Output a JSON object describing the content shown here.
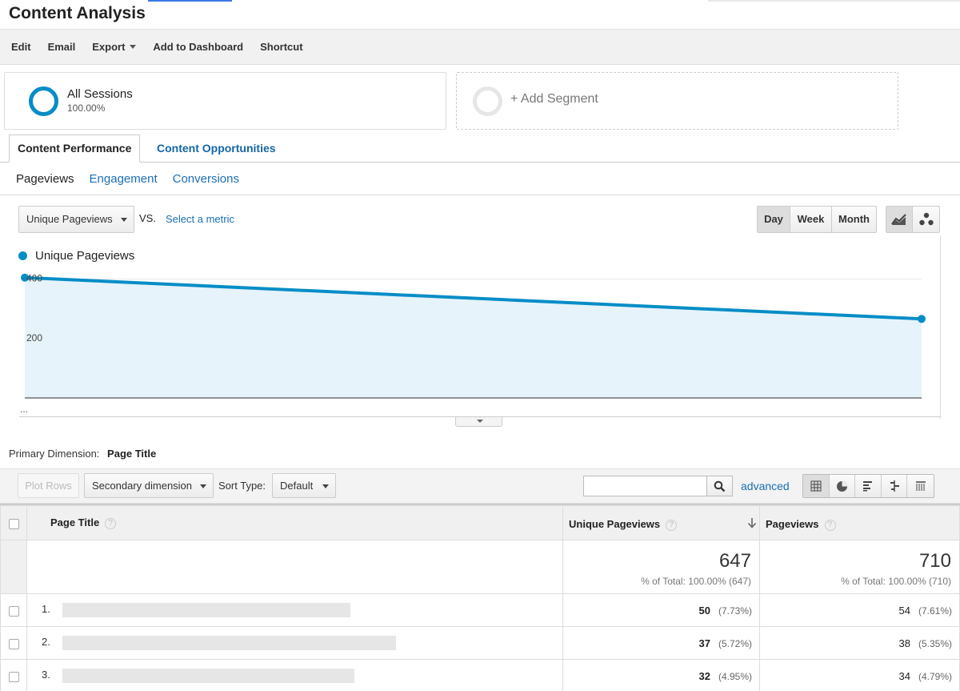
{
  "page": {
    "title": "Content Analysis"
  },
  "toolbar": {
    "edit": "Edit",
    "email": "Email",
    "export": "Export",
    "add_to_dashboard": "Add to Dashboard",
    "shortcut": "Shortcut"
  },
  "segments": {
    "active": {
      "name": "All Sessions",
      "percent": "100.00%"
    },
    "add_label": "+ Add Segment"
  },
  "report_tabs": [
    "Content Performance",
    "Content Opportunities"
  ],
  "sub_tabs": [
    "Pageviews",
    "Engagement",
    "Conversions"
  ],
  "chart_controls": {
    "metric": "Unique Pageviews",
    "vs": "VS.",
    "select_metric": "Select a metric",
    "periods": [
      "Day",
      "Week",
      "Month"
    ],
    "active_period": "Day",
    "chart_types": [
      "line-chart-icon",
      "motion-chart-icon"
    ]
  },
  "chart_data": {
    "type": "area",
    "series": [
      {
        "name": "Unique Pageviews",
        "values": [
          405,
          266
        ]
      }
    ],
    "y_ticks": [
      400,
      200
    ],
    "x_label": "...",
    "ylim": [
      0,
      450
    ],
    "colors": {
      "line": "#058dc7",
      "fill": "#e6f3fa"
    }
  },
  "primary_dimension": {
    "label": "Primary Dimension:",
    "value": "Page Title"
  },
  "table_controls": {
    "plot_rows": "Plot Rows",
    "secondary_dimension": "Secondary dimension",
    "sort_type_label": "Sort Type:",
    "sort_type": "Default",
    "search_placeholder": "",
    "advanced": "advanced"
  },
  "table": {
    "columns": [
      "Page Title",
      "Unique Pageviews",
      "Pageviews"
    ],
    "totals": [
      {
        "value": "647",
        "sub": "% of Total: 100.00% (647)"
      },
      {
        "value": "710",
        "sub": "% of Total: 100.00% (710)"
      }
    ],
    "rows": [
      {
        "index": "1.",
        "unique": "50",
        "unique_pct": "(7.73%)",
        "views": "54",
        "views_pct": "(7.61%)"
      },
      {
        "index": "2.",
        "unique": "37",
        "unique_pct": "(5.72%)",
        "views": "38",
        "views_pct": "(5.35%)"
      },
      {
        "index": "3.",
        "unique": "32",
        "unique_pct": "(4.95%)",
        "views": "34",
        "views_pct": "(4.79%)"
      }
    ]
  }
}
